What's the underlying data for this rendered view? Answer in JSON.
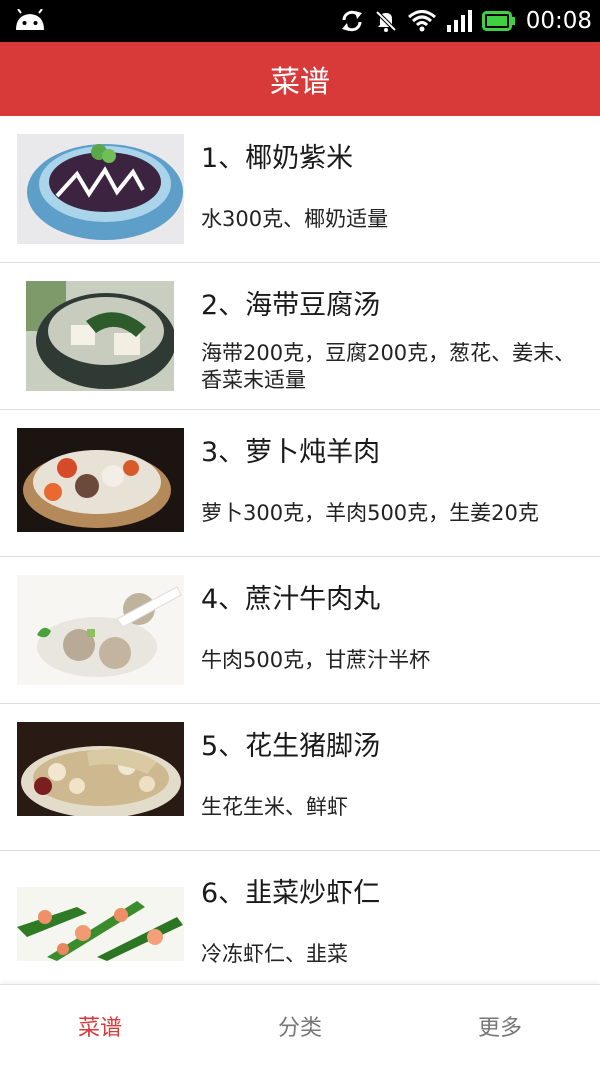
{
  "status_bar": {
    "time": "00:08",
    "icons": [
      "android-icon",
      "sync-icon",
      "mute-icon",
      "wifi-icon",
      "signal-icon",
      "battery-icon"
    ],
    "battery_color": "#3fd13f"
  },
  "header": {
    "title": "菜谱",
    "color": "#d83a3a"
  },
  "recipes": [
    {
      "name": "1、椰奶紫米",
      "ingredients": "水300克、椰奶适量"
    },
    {
      "name": "2、海带豆腐汤",
      "ingredients": "海带200克，豆腐200克，葱花、姜末、香菜末适量"
    },
    {
      "name": "3、萝卜炖羊肉",
      "ingredients": "萝卜300克，羊肉500克，生姜20克"
    },
    {
      "name": "4、蔗汁牛肉丸",
      "ingredients": "牛肉500克，甘蔗汁半杯"
    },
    {
      "name": "5、花生猪脚汤",
      "ingredients": "生花生米、鲜虾"
    },
    {
      "name": "6、韭菜炒虾仁",
      "ingredients": "冷冻虾仁、韭菜"
    }
  ],
  "bottom_nav": {
    "tabs": [
      {
        "label": "菜谱",
        "active": true
      },
      {
        "label": "分类",
        "active": false
      },
      {
        "label": "更多",
        "active": false
      }
    ]
  }
}
